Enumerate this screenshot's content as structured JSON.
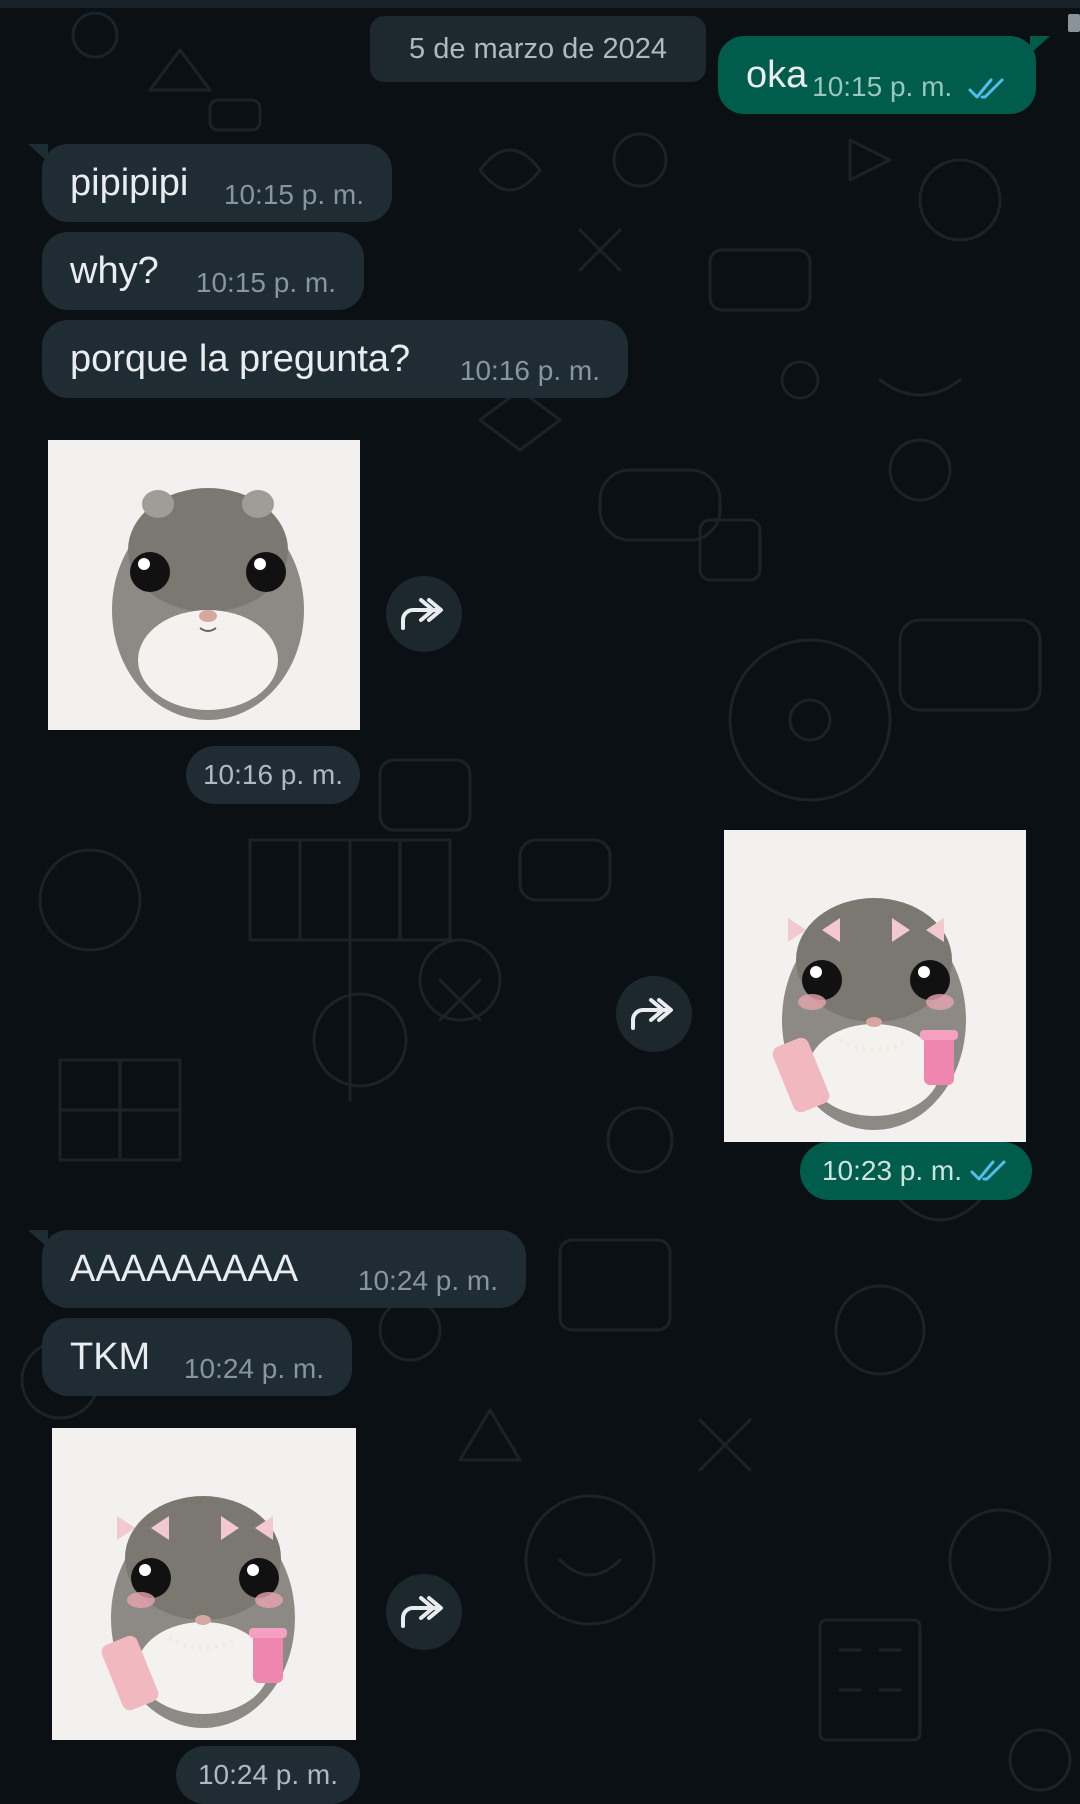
{
  "date_separator": "5 de marzo de 2024",
  "messages": [
    {
      "direction": "out",
      "text": "oka",
      "time": "10:15 p. m.",
      "status": "read"
    },
    {
      "direction": "in",
      "text": "pipipipi",
      "time": "10:15 p. m."
    },
    {
      "direction": "in",
      "text": "why?",
      "time": "10:15 p. m."
    },
    {
      "direction": "in",
      "text": "porque la pregunta?",
      "time": "10:16 p. m."
    },
    {
      "direction": "in",
      "type": "sticker",
      "sticker": "sad-hamster",
      "time": "10:16 p. m."
    },
    {
      "direction": "out",
      "type": "sticker",
      "sticker": "hamster-with-bows-phone-cup",
      "time": "10:23 p. m.",
      "status": "read"
    },
    {
      "direction": "in",
      "text": "AAAAAAAAA",
      "time": "10:24 p. m."
    },
    {
      "direction": "in",
      "text": "TKM",
      "time": "10:24 p. m."
    },
    {
      "direction": "in",
      "type": "sticker",
      "sticker": "hamster-with-bows-phone-cup",
      "time": "10:24 p. m."
    }
  ],
  "colors": {
    "background": "#0b1014",
    "incoming_bubble": "#1f2c33",
    "outgoing_bubble": "#005c4b",
    "read_ticks": "#53bdeb",
    "timestamp": "#8696a0"
  },
  "icons": {
    "forward": "forward-arrow-icon",
    "read_receipt": "double-check-icon"
  }
}
